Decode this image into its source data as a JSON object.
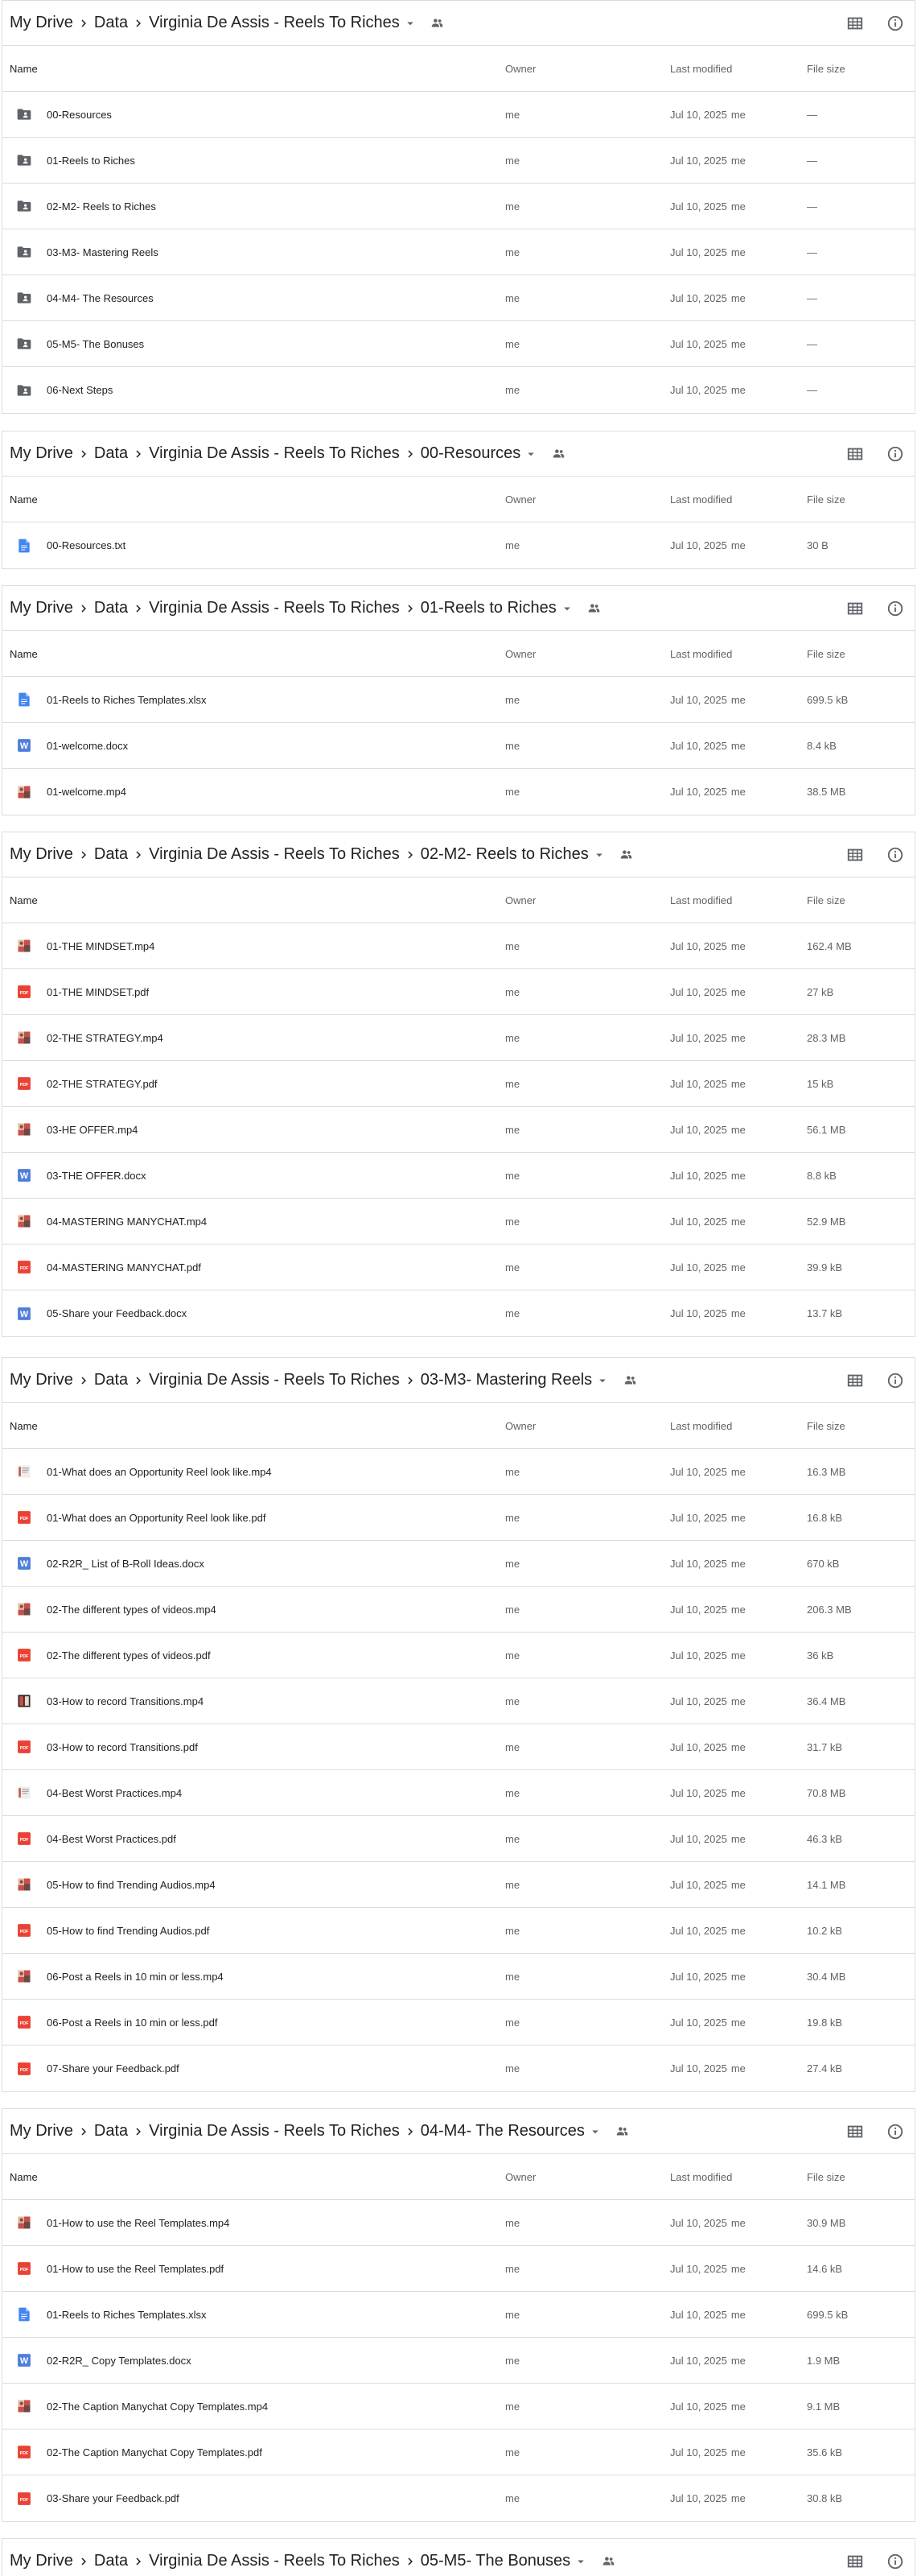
{
  "columns": {
    "name": "Name",
    "owner": "Owner",
    "modified": "Last modified",
    "size": "File size"
  },
  "panels": [
    {
      "crumbs": [
        "My Drive",
        "Data",
        "Virginia De Assis - Reels To Riches"
      ],
      "rows": [
        {
          "icon": "folder-shared",
          "name": "00-Resources",
          "owner": "me",
          "date": "Jul 10, 2025",
          "by": "me",
          "size": "—"
        },
        {
          "icon": "folder-shared",
          "name": "01-Reels to Riches",
          "owner": "me",
          "date": "Jul 10, 2025",
          "by": "me",
          "size": "—"
        },
        {
          "icon": "folder-shared",
          "name": "02-M2- Reels to Riches",
          "owner": "me",
          "date": "Jul 10, 2025",
          "by": "me",
          "size": "—"
        },
        {
          "icon": "folder-shared",
          "name": "03-M3- Mastering Reels",
          "owner": "me",
          "date": "Jul 10, 2025",
          "by": "me",
          "size": "—"
        },
        {
          "icon": "folder-shared",
          "name": "04-M4- The Resources",
          "owner": "me",
          "date": "Jul 10, 2025",
          "by": "me",
          "size": "—"
        },
        {
          "icon": "folder-shared",
          "name": "05-M5- The Bonuses",
          "owner": "me",
          "date": "Jul 10, 2025",
          "by": "me",
          "size": "—"
        },
        {
          "icon": "folder-shared",
          "name": "06-Next Steps",
          "owner": "me",
          "date": "Jul 10, 2025",
          "by": "me",
          "size": "—"
        }
      ]
    },
    {
      "crumbs": [
        "My Drive",
        "Data",
        "Virginia De Assis - Reels To Riches",
        "00-Resources"
      ],
      "rows": [
        {
          "icon": "doc",
          "name": "00-Resources.txt",
          "owner": "me",
          "date": "Jul 10, 2025",
          "by": "me",
          "size": "30 B"
        }
      ]
    },
    {
      "crumbs": [
        "My Drive",
        "Data",
        "Virginia De Assis - Reels To Riches",
        "01-Reels to Riches"
      ],
      "rows": [
        {
          "icon": "doc",
          "name": "01-Reels to Riches Templates.xlsx",
          "owner": "me",
          "date": "Jul 10, 2025",
          "by": "me",
          "size": "699.5 kB"
        },
        {
          "icon": "word",
          "name": "01-welcome.docx",
          "owner": "me",
          "date": "Jul 10, 2025",
          "by": "me",
          "size": "8.4 kB"
        },
        {
          "icon": "video",
          "name": "01-welcome.mp4",
          "owner": "me",
          "date": "Jul 10, 2025",
          "by": "me",
          "size": "38.5 MB"
        }
      ]
    },
    {
      "crumbs": [
        "My Drive",
        "Data",
        "Virginia De Assis - Reels To Riches",
        "02-M2- Reels to Riches"
      ],
      "rows": [
        {
          "icon": "video",
          "name": "01-THE MINDSET.mp4",
          "owner": "me",
          "date": "Jul 10, 2025",
          "by": "me",
          "size": "162.4 MB"
        },
        {
          "icon": "pdf",
          "name": "01-THE MINDSET.pdf",
          "owner": "me",
          "date": "Jul 10, 2025",
          "by": "me",
          "size": "27 kB"
        },
        {
          "icon": "video",
          "name": "02-THE STRATEGY.mp4",
          "owner": "me",
          "date": "Jul 10, 2025",
          "by": "me",
          "size": "28.3 MB"
        },
        {
          "icon": "pdf",
          "name": "02-THE STRATEGY.pdf",
          "owner": "me",
          "date": "Jul 10, 2025",
          "by": "me",
          "size": "15 kB"
        },
        {
          "icon": "video",
          "name": "03-HE OFFER.mp4",
          "owner": "me",
          "date": "Jul 10, 2025",
          "by": "me",
          "size": "56.1 MB"
        },
        {
          "icon": "word",
          "name": "03-THE OFFER.docx",
          "owner": "me",
          "date": "Jul 10, 2025",
          "by": "me",
          "size": "8.8 kB"
        },
        {
          "icon": "video",
          "name": "04-MASTERING MANYCHAT.mp4",
          "owner": "me",
          "date": "Jul 10, 2025",
          "by": "me",
          "size": "52.9 MB"
        },
        {
          "icon": "pdf",
          "name": "04-MASTERING MANYCHAT.pdf",
          "owner": "me",
          "date": "Jul 10, 2025",
          "by": "me",
          "size": "39.9 kB"
        },
        {
          "icon": "word",
          "name": "05-Share your Feedback.docx",
          "owner": "me",
          "date": "Jul 10, 2025",
          "by": "me",
          "size": "13.7 kB"
        }
      ]
    },
    {
      "crumbs": [
        "My Drive",
        "Data",
        "Virginia De Assis - Reels To Riches",
        "03-M3- Mastering Reels"
      ],
      "rows": [
        {
          "icon": "video-light",
          "name": "01-What does an Opportunity Reel look like.mp4",
          "owner": "me",
          "date": "Jul 10, 2025",
          "by": "me",
          "size": "16.3 MB"
        },
        {
          "icon": "pdf",
          "name": "01-What does an Opportunity Reel look like.pdf",
          "owner": "me",
          "date": "Jul 10, 2025",
          "by": "me",
          "size": "16.8 kB"
        },
        {
          "icon": "word",
          "name": "02-R2R_ List of B-Roll Ideas.docx",
          "owner": "me",
          "date": "Jul 10, 2025",
          "by": "me",
          "size": "670 kB"
        },
        {
          "icon": "video",
          "name": "02-The different types of videos.mp4",
          "owner": "me",
          "date": "Jul 10, 2025",
          "by": "me",
          "size": "206.3 MB"
        },
        {
          "icon": "pdf",
          "name": "02-The different types of videos.pdf",
          "owner": "me",
          "date": "Jul 10, 2025",
          "by": "me",
          "size": "36 kB"
        },
        {
          "icon": "video-dark",
          "name": "03-How to record Transitions.mp4",
          "owner": "me",
          "date": "Jul 10, 2025",
          "by": "me",
          "size": "36.4 MB"
        },
        {
          "icon": "pdf",
          "name": "03-How to record Transitions.pdf",
          "owner": "me",
          "date": "Jul 10, 2025",
          "by": "me",
          "size": "31.7 kB"
        },
        {
          "icon": "video-light",
          "name": "04-Best Worst Practices.mp4",
          "owner": "me",
          "date": "Jul 10, 2025",
          "by": "me",
          "size": "70.8 MB"
        },
        {
          "icon": "pdf",
          "name": "04-Best Worst Practices.pdf",
          "owner": "me",
          "date": "Jul 10, 2025",
          "by": "me",
          "size": "46.3 kB"
        },
        {
          "icon": "video",
          "name": "05-How to find Trending Audios.mp4",
          "owner": "me",
          "date": "Jul 10, 2025",
          "by": "me",
          "size": "14.1 MB"
        },
        {
          "icon": "pdf",
          "name": "05-How to find Trending Audios.pdf",
          "owner": "me",
          "date": "Jul 10, 2025",
          "by": "me",
          "size": "10.2 kB"
        },
        {
          "icon": "video",
          "name": "06-Post a Reels in 10 min or less.mp4",
          "owner": "me",
          "date": "Jul 10, 2025",
          "by": "me",
          "size": "30.4 MB"
        },
        {
          "icon": "pdf",
          "name": "06-Post a Reels in 10 min or less.pdf",
          "owner": "me",
          "date": "Jul 10, 2025",
          "by": "me",
          "size": "19.8 kB"
        },
        {
          "icon": "pdf",
          "name": "07-Share your Feedback.pdf",
          "owner": "me",
          "date": "Jul 10, 2025",
          "by": "me",
          "size": "27.4 kB"
        }
      ]
    },
    {
      "crumbs": [
        "My Drive",
        "Data",
        "Virginia De Assis - Reels To Riches",
        "04-M4- The Resources"
      ],
      "rows": [
        {
          "icon": "video",
          "name": "01-How to use the Reel Templates.mp4",
          "owner": "me",
          "date": "Jul 10, 2025",
          "by": "me",
          "size": "30.9 MB"
        },
        {
          "icon": "pdf",
          "name": "01-How to use the Reel Templates.pdf",
          "owner": "me",
          "date": "Jul 10, 2025",
          "by": "me",
          "size": "14.6 kB"
        },
        {
          "icon": "doc",
          "name": "01-Reels to Riches Templates.xlsx",
          "owner": "me",
          "date": "Jul 10, 2025",
          "by": "me",
          "size": "699.5 kB"
        },
        {
          "icon": "word",
          "name": "02-R2R_ Copy Templates.docx",
          "owner": "me",
          "date": "Jul 10, 2025",
          "by": "me",
          "size": "1.9 MB"
        },
        {
          "icon": "video",
          "name": "02-The Caption Manychat Copy Templates.mp4",
          "owner": "me",
          "date": "Jul 10, 2025",
          "by": "me",
          "size": "9.1 MB"
        },
        {
          "icon": "pdf",
          "name": "02-The Caption Manychat Copy Templates.pdf",
          "owner": "me",
          "date": "Jul 10, 2025",
          "by": "me",
          "size": "35.6 kB"
        },
        {
          "icon": "pdf",
          "name": "03-Share your Feedback.pdf",
          "owner": "me",
          "date": "Jul 10, 2025",
          "by": "me",
          "size": "30.8 kB"
        }
      ]
    },
    {
      "crumbs": [
        "My Drive",
        "Data",
        "Virginia De Assis - Reels To Riches",
        "05-M5- The Bonuses"
      ],
      "rows": []
    }
  ]
}
